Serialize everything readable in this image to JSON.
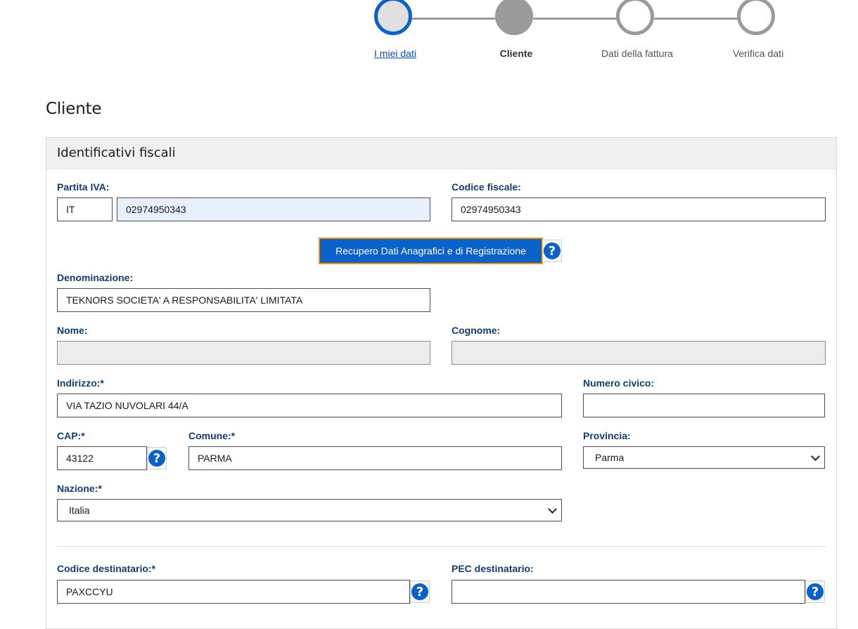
{
  "stepper": {
    "steps": [
      {
        "label": "I miei dati"
      },
      {
        "label": "Cliente"
      },
      {
        "label": "Dati della fattura"
      },
      {
        "label": "Verifica dati"
      }
    ],
    "current_step": 2
  },
  "page": {
    "title": "Cliente"
  },
  "section": {
    "title": "Identificativi fiscali"
  },
  "form": {
    "partita_iva": {
      "label": "Partita IVA:",
      "country": "IT",
      "value": "02974950343"
    },
    "codice_fiscale": {
      "label": "Codice fiscale:",
      "value": "02974950343"
    },
    "recupero_button": "Recupero Dati Anagrafici e di Registrazione",
    "denominazione": {
      "label": "Denominazione:",
      "value": "TEKNORS SOCIETA' A RESPONSABILITA' LIMITATA"
    },
    "nome": {
      "label": "Nome:",
      "value": ""
    },
    "cognome": {
      "label": "Cognome:",
      "value": ""
    },
    "indirizzo": {
      "label": "Indirizzo:*",
      "value": "VIA TAZIO NUVOLARI 44/A"
    },
    "numero_civico": {
      "label": "Numero civico:",
      "value": ""
    },
    "cap": {
      "label": "CAP:*",
      "value": "43122"
    },
    "comune": {
      "label": "Comune:*",
      "value": "PARMA"
    },
    "provincia": {
      "label": "Provincia:",
      "selected": "Parma"
    },
    "nazione": {
      "label": "Nazione:*",
      "selected": "Italia"
    },
    "codice_destinatario": {
      "label": "Codice destinatario:*",
      "value": "PAXCCYU"
    },
    "pec_destinatario": {
      "label": "PEC destinatario:",
      "value": ""
    }
  },
  "colors": {
    "primary": "#0a62c9",
    "focus_outline": "#f29100",
    "label": "#123d6e",
    "step_inactive": "#9b9b9b"
  },
  "icons": {
    "help": "question-circle-icon",
    "dropdown": "chevron-down-icon"
  }
}
